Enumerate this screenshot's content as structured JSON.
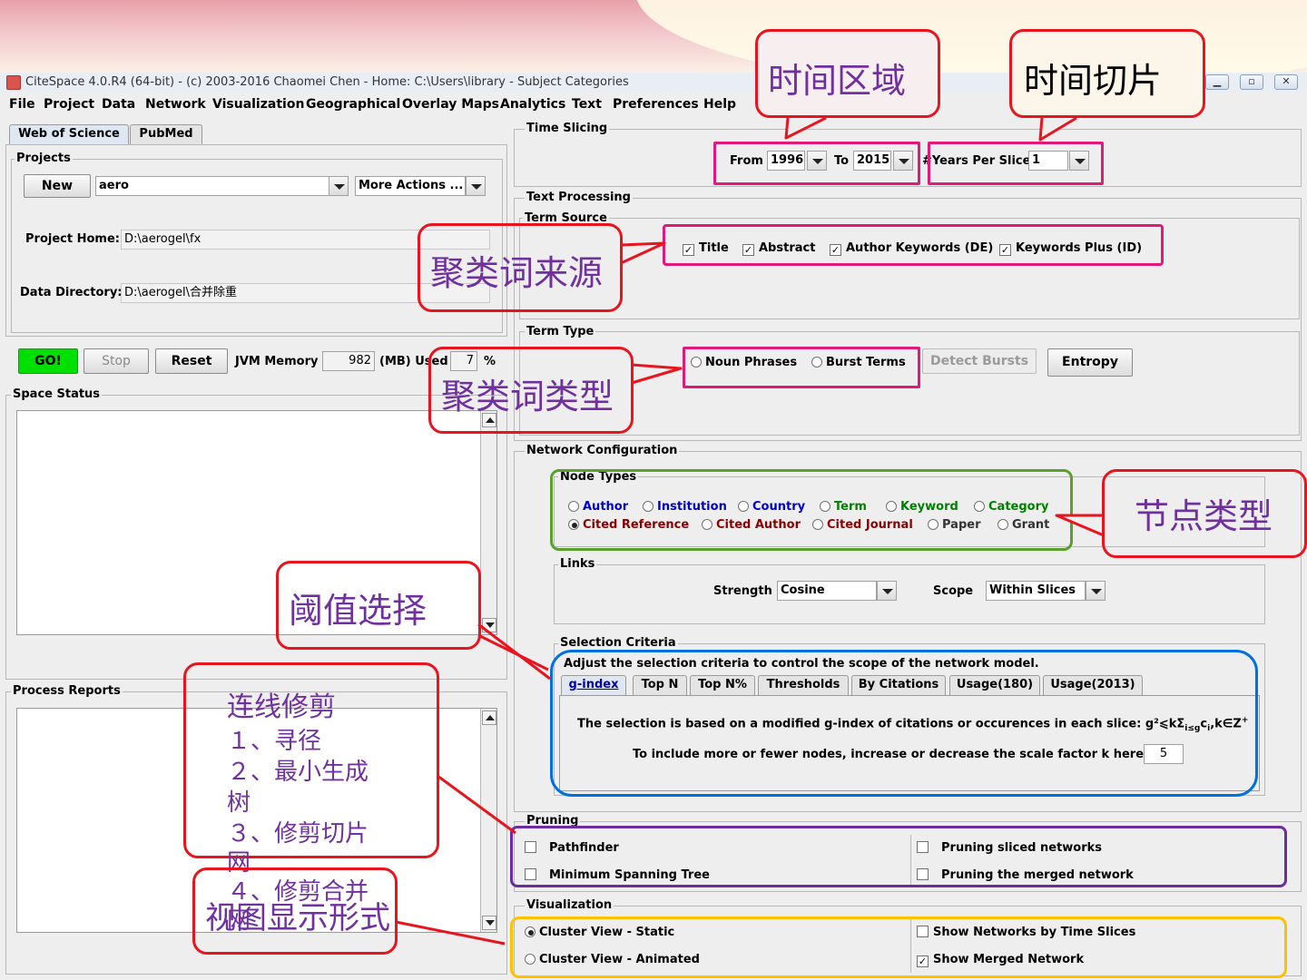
{
  "window": {
    "title": "CiteSpace 4.0.R4 (64-bit) - (c) 2003-2016 Chaomei Chen - Home: C:\\Users\\library - Subject Categories"
  },
  "menu": [
    "File",
    "Project",
    "Data",
    "Network",
    "Visualization",
    "Geographical",
    "Overlay Maps",
    "Analytics",
    "Text",
    "Preferences",
    "Help"
  ],
  "left": {
    "tabs": [
      "Web of Science",
      "PubMed"
    ],
    "projects_legend": "Projects",
    "new_label": "New",
    "project_value": "aero",
    "more_actions": "More Actions ...",
    "project_home_label": "Project Home:",
    "project_home_value": "D:\\aerogel\\fx",
    "data_dir_label": "Data Directory:",
    "data_dir_value": "D:\\aerogel\\合并除重",
    "go_label": "GO!",
    "stop_label": "Stop",
    "reset_label": "Reset",
    "jvm_label": "JVM Memory",
    "jvm_value": "982",
    "used_label": "(MB) Used",
    "used_value": "7",
    "pct": "%",
    "space_status": "Space Status",
    "process_reports": "Process Reports"
  },
  "time_slicing": {
    "legend": "Time Slicing",
    "from_label": "From",
    "from_value": "1996",
    "to_label": "To",
    "to_value": "2015",
    "years_label": "#Years Per Slice",
    "years_value": "1"
  },
  "text_processing": {
    "legend": "Text Processing",
    "term_source": "Term Source",
    "sources": [
      "Title",
      "Abstract",
      "Author Keywords (DE)",
      "Keywords Plus (ID)"
    ],
    "term_type": "Term Type",
    "noun_phrases": "Noun Phrases",
    "burst_terms": "Burst Terms",
    "detect_bursts": "Detect Bursts",
    "entropy": "Entropy"
  },
  "network": {
    "legend": "Network Configuration",
    "node_types_legend": "Node Types",
    "node_row1": [
      "Author",
      "Institution",
      "Country",
      "Term",
      "Keyword",
      "Category"
    ],
    "node_row2": [
      "Cited Reference",
      "Cited Author",
      "Cited Journal",
      "Paper",
      "Grant"
    ],
    "links_legend": "Links",
    "strength_label": "Strength",
    "strength_value": "Cosine",
    "scope_label": "Scope",
    "scope_value": "Within Slices",
    "selection_legend": "Selection Criteria",
    "selection_hint": "Adjust the selection criteria to control the scope of the network model.",
    "sel_tabs": [
      "g-index",
      "Top N",
      "Top N%",
      "Thresholds",
      "By Citations",
      "Usage(180)",
      "Usage(2013)"
    ],
    "gindex_text": "The selection is based on a modified g-index of citations or occurences in each slice: g²⩽kΣ",
    "gindex_sub": "i≤g",
    "gindex_tail": "c",
    "gindex_sub2": "i",
    "gindex_end": ",k∈Z",
    "gindex_sup": "+",
    "scale_text": "To include more or fewer nodes, increase or decrease the scale factor k here: k=",
    "k_value": "5"
  },
  "pruning": {
    "legend": "Pruning",
    "items": [
      "Pathfinder",
      "Minimum Spanning Tree",
      "Pruning sliced networks",
      "Pruning the merged network"
    ]
  },
  "visualization": {
    "legend": "Visualization",
    "items": [
      "Cluster View - Static",
      "Cluster View - Animated",
      "Show Networks by Time Slices",
      "Show Merged Network"
    ]
  },
  "annotations": {
    "time_region": "时间区域",
    "time_slice": "时间切片",
    "term_source": "聚类词来源",
    "term_type": "聚类词类型",
    "node_type": "节点类型",
    "threshold": "阈值选择",
    "pruning_title": "连线修剪",
    "pruning_1": "１、寻径",
    "pruning_2": "２、最小生成",
    "pruning_2b": "树",
    "pruning_3": "３、修剪切片",
    "pruning_3b": "网",
    "pruning_4": "４、修剪合并",
    "pruning_4b": "网",
    "view_form": "视图显示形式"
  },
  "colors": {
    "red": "#e8141e",
    "pink": "#e0197a",
    "green": "#5aa02c",
    "blue": "#0070e0",
    "purple": "#6a2ca0",
    "orange": "#ffc000",
    "annotation_text": "#7030a0",
    "go": "#00e000"
  }
}
